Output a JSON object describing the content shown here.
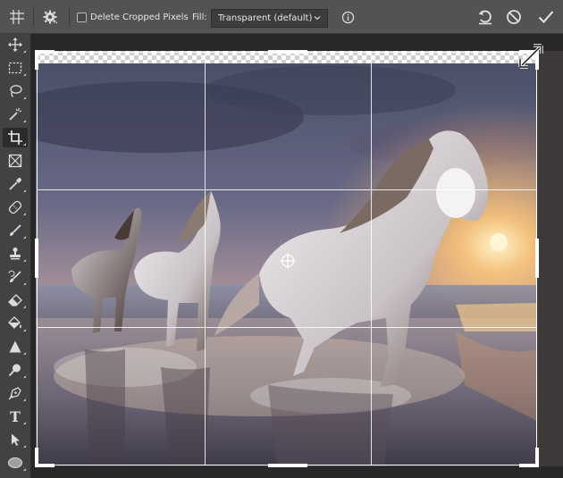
{
  "options_bar": {
    "tool_preset_icon": "crop-grid-icon",
    "overlay_settings_icon": "gear-icon",
    "delete_cropped_label": "Delete Cropped Pixels",
    "delete_cropped_checked": false,
    "fill_label": "Fill:",
    "fill_value": "Transparent (default)",
    "info_icon": "info-icon",
    "reset_icon": "reset-icon",
    "cancel_icon": "cancel-icon",
    "commit_icon": "commit-check-icon"
  },
  "tools": [
    {
      "name": "move-tool"
    },
    {
      "name": "rectangular-marquee-tool"
    },
    {
      "name": "lasso-tool"
    },
    {
      "name": "magic-wand-tool"
    },
    {
      "name": "crop-tool",
      "active": true
    },
    {
      "name": "frame-tool"
    },
    {
      "name": "eyedropper-tool"
    },
    {
      "name": "healing-brush-tool"
    },
    {
      "name": "brush-tool"
    },
    {
      "name": "clone-stamp-tool"
    },
    {
      "name": "history-brush-tool"
    },
    {
      "name": "eraser-tool"
    },
    {
      "name": "paint-bucket-tool"
    },
    {
      "name": "sharpen-tool"
    },
    {
      "name": "dodge-tool"
    },
    {
      "name": "pen-tool"
    },
    {
      "name": "type-tool",
      "glyph": "T"
    },
    {
      "name": "path-selection-tool"
    },
    {
      "name": "ellipse-tool"
    }
  ],
  "canvas": {
    "image_subject": "horses galloping on beach at sunset",
    "crop_overlay": "rule-of-thirds"
  }
}
